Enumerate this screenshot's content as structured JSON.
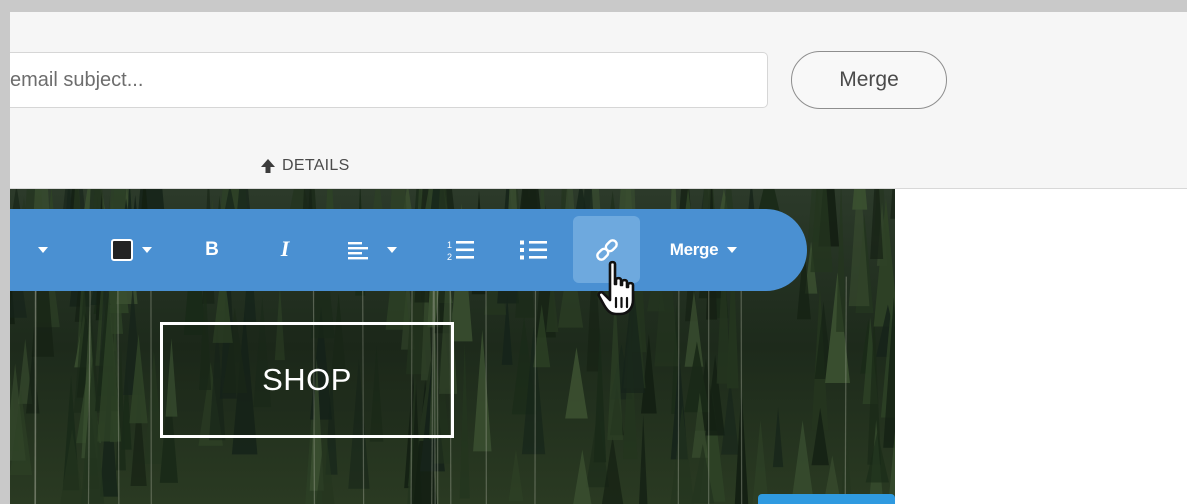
{
  "subject": {
    "value": "",
    "placeholder": "email subject..."
  },
  "merge_button_label": "Merge",
  "details_label": "DETAILS",
  "toolbar": {
    "merge_menu_label": "Merge",
    "bold_label": "B",
    "italic_label": "I",
    "text_color": "#222222",
    "accent": "#4a90d2"
  },
  "content": {
    "shop_label": "SHOP"
  },
  "icons": [
    "arrow-up-icon",
    "chevron-down-icon",
    "color-swatch-icon",
    "bold-icon",
    "italic-icon",
    "align-left-icon",
    "ordered-list-icon",
    "unordered-list-icon",
    "link-icon",
    "hand-pointer-cursor"
  ]
}
